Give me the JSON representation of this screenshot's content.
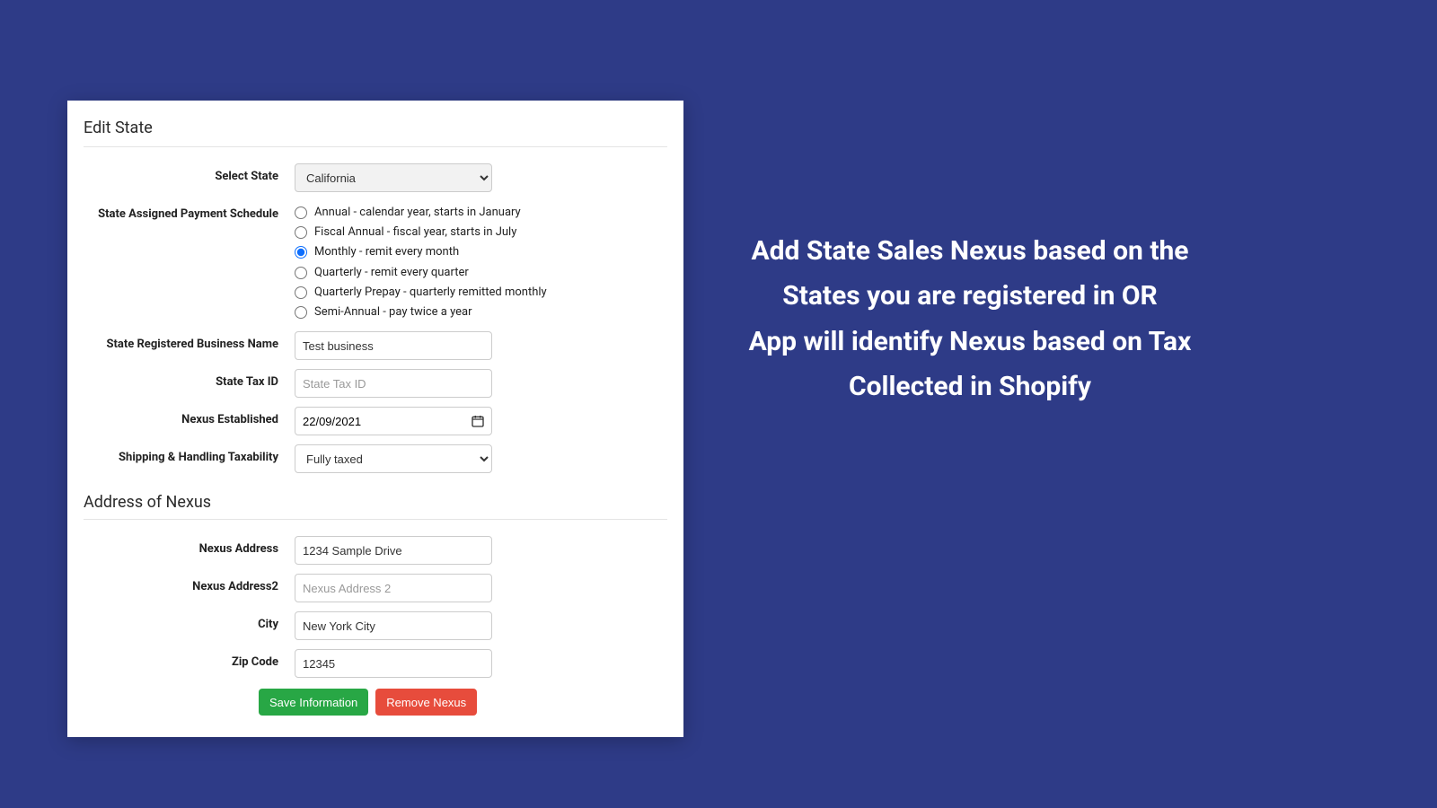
{
  "panel": {
    "title": "Edit State",
    "labels": {
      "select_state": "Select State",
      "schedule": "State Assigned Payment Schedule",
      "business_name": "State Registered Business Name",
      "tax_id": "State Tax ID",
      "nexus_established": "Nexus Established",
      "shipping_tax": "Shipping & Handling Taxability",
      "address_title": "Address of Nexus",
      "nexus_address": "Nexus Address",
      "nexus_address2": "Nexus Address2",
      "city": "City",
      "zip": "Zip Code"
    },
    "values": {
      "select_state": "California",
      "business_name": "Test business",
      "tax_id": "",
      "tax_id_placeholder": "State Tax ID",
      "nexus_established": "22/09/2021",
      "shipping_tax": "Fully taxed",
      "nexus_address": "1234 Sample Drive",
      "nexus_address2": "",
      "nexus_address2_placeholder": "Nexus Address 2",
      "city": "New York City",
      "zip": "12345"
    },
    "schedule_options": [
      "Annual - calendar year, starts in January",
      "Fiscal Annual - fiscal year, starts in July",
      "Monthly - remit every month",
      "Quarterly - remit every quarter",
      "Quarterly Prepay - quarterly remitted monthly",
      "Semi-Annual - pay twice a year"
    ],
    "schedule_selected_index": 2,
    "buttons": {
      "save": "Save Information",
      "remove": "Remove Nexus"
    }
  },
  "marketing": {
    "line1": "Add State Sales Nexus based on the States you are registered in OR",
    "line2": "App will identify Nexus based on Tax Collected in Shopify"
  }
}
